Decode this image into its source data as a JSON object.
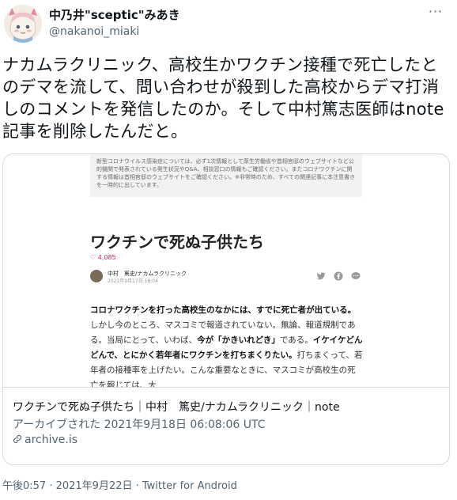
{
  "tweet": {
    "display_name": "中乃井\"sceptic\"みあき",
    "handle": "@nakanoi_miaki",
    "more_label": "···",
    "text": "ナカムラクリニック、高校生かワクチン接種で死亡したとのデマを流して、問い合わせが殺到した高校からデマ打消しのコメントを発信したのか。そして中村篤志医師はnote記事を削除したんだと。",
    "timestamp": "午後0:57 · 2021年9月22日 · Twitter for Android"
  },
  "card": {
    "notice": "新型コロナウイルス感染症については、必ず1次情報として厚生労働省や首相官邸のウェブサイトなど公的機関で発表されている発生状況やQ&A、相談窓口の情報もご確認ください。またコロナワクチンに関する情報は首相官邸のウェブサイトをご確認ください。※非常時のため、すべての関連記事に本注意書きを一時的に出しています。",
    "article_title": "ワクチンで死ぬ子供たち",
    "likes": "♡ 4,085",
    "author_name": "中村　篤史/ナカムラクリニック",
    "author_date": "2021年9月17日 18:04",
    "body_p1_bold": "コロナワクチンを打った高校生のなかには、すでに死亡者が出ている。",
    "body_p1_rest": "しかし今のところ、マスコミで報道されていない。無論、報道規制である。当局にとって、いわば、",
    "body_p1_bold2": "今が「かきいれどき」",
    "body_p1_rest2": "である。",
    "body_p1_bold3": "イケイケどんどんで、とにかく若年者にワクチンを打ちまくりたい。",
    "body_p1_rest3": "打ちまくって、若年者の接種率を上げたい。こんな重要なときに、マスコミが高校生の死亡を報じては、大",
    "title": "ワクチンで死ぬ子供たち｜中村　篤史/ナカムラクリニック｜note",
    "archived": "アーカイブされた 2021年9月18日 06:08:06 UTC",
    "domain": "archive.is"
  },
  "icons": {
    "more": "more-horizontal-icon",
    "link": "link-icon",
    "share": [
      "twitter-icon",
      "facebook-icon",
      "comment-icon"
    ]
  },
  "colors": {
    "text": "#0f1419",
    "secondary": "#536471",
    "border": "#cfd9de",
    "like": "#e0245e"
  }
}
